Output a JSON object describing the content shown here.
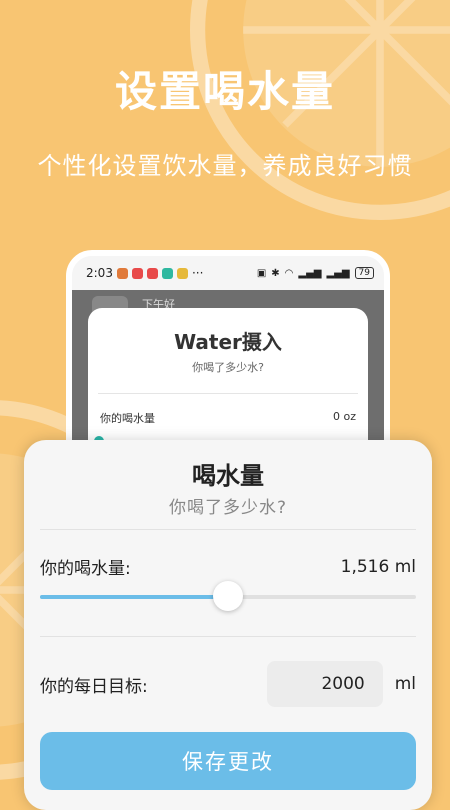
{
  "promo": {
    "title": "设置喝水量",
    "subtitle": "个性化设置饮水量，养成良好习惯"
  },
  "statusbar": {
    "time": "2:03",
    "more": "···",
    "battery": "79"
  },
  "background_screen": {
    "greeting": "下午好"
  },
  "inner_dialog": {
    "title": "Water摄入",
    "subtitle": "你喝了多少水?",
    "intake_label": "你的喝水量",
    "intake_value": "0 oz",
    "slider_fraction": 0.0
  },
  "dialog": {
    "title": "喝水量",
    "subtitle": "你喝了多少水?",
    "intake_label": "你的喝水量:",
    "intake_value": "1,516 ml",
    "slider_fraction": 0.5,
    "goal_label": "你的每日目标:",
    "goal_value": "2000",
    "goal_unit": "ml",
    "save_label": "保存更改"
  },
  "colors": {
    "background": "#f8c572",
    "accent": "#6bbde8",
    "inner_thumb": "#2ab5a8"
  }
}
